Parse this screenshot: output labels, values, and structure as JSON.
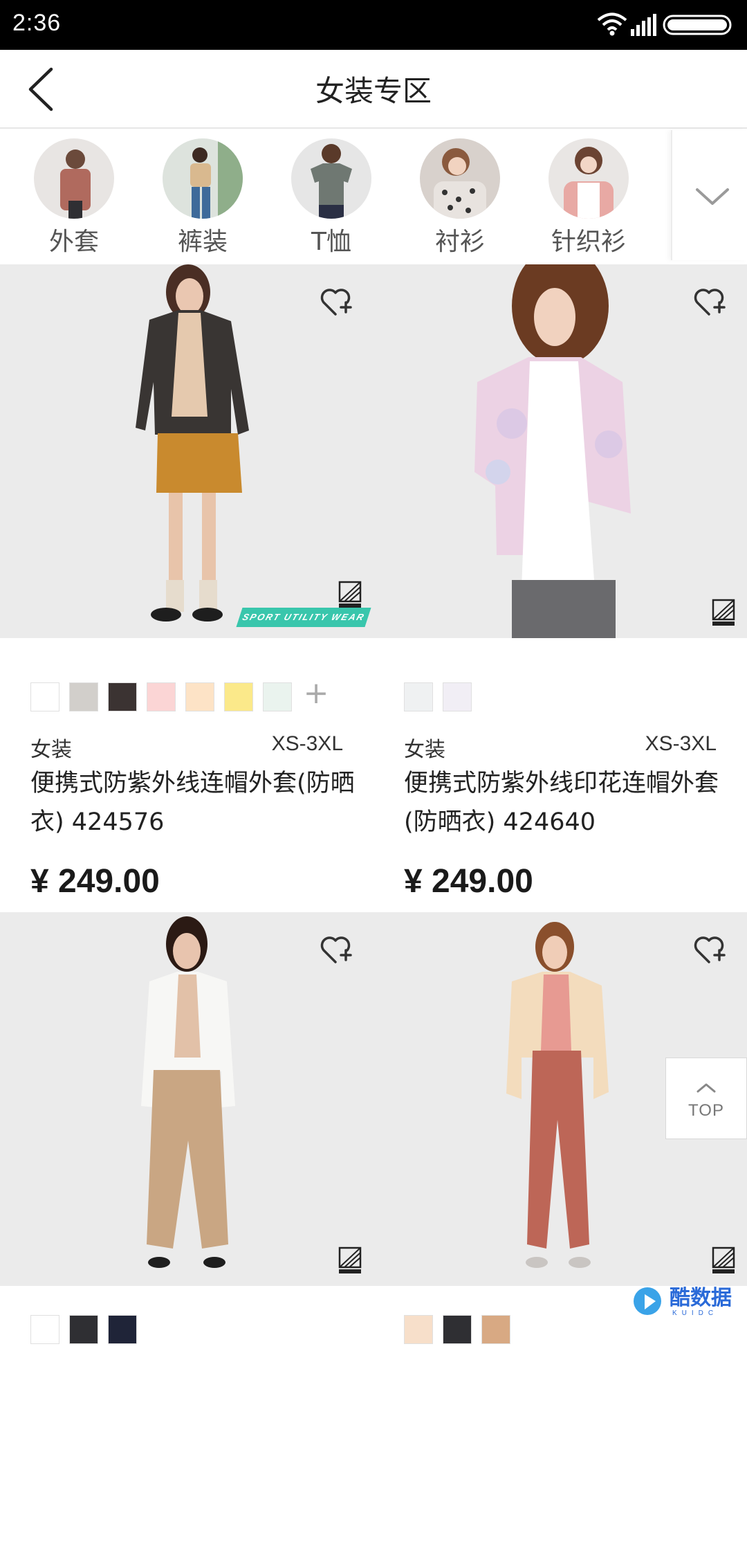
{
  "status_bar": {
    "time": "2:36"
  },
  "header": {
    "title": "女装专区"
  },
  "categories": [
    {
      "label": "外套",
      "thumb_color": "#b06a5e"
    },
    {
      "label": "裤装",
      "thumb_color": "#d9b98f"
    },
    {
      "label": "T恤",
      "thumb_color": "#6f7872"
    },
    {
      "label": "衬衫",
      "thumb_color": "#e8e3df"
    },
    {
      "label": "针织衫",
      "thumb_color": "#e8a9a4"
    }
  ],
  "products": [
    {
      "swatches": [
        "#ffffff",
        "#d2cfcb",
        "#3b3332",
        "#fbd5d5",
        "#fde3c6",
        "#fbe98a",
        "#eaf3ee"
      ],
      "has_more_swatches": true,
      "more_symbol": "+",
      "category": "女装",
      "size": "XS-3XL",
      "name": "便携式防紫外线连帽外套(防晒衣) 424576",
      "price": "¥ 249.00",
      "tag": "SPORT UTILITY WEAR"
    },
    {
      "swatches": [
        "#eff1f2",
        "#f1eef5"
      ],
      "has_more_swatches": false,
      "category": "女装",
      "size": "XS-3XL",
      "name": "便携式防紫外线印花连帽外套(防晒衣) 424640",
      "price": "¥ 249.00"
    },
    {
      "swatches": [
        "#ffffff",
        "#2f2f33",
        "#1f2438"
      ],
      "has_more_swatches": false
    },
    {
      "swatches": [
        "#f7dfca",
        "#2f2f33",
        "#d8a983"
      ],
      "has_more_swatches": false
    }
  ],
  "top_button": {
    "label": "TOP"
  },
  "watermark": {
    "text": "酷数据",
    "sub": "KUIDC"
  },
  "colors": {
    "image_bg": "#ebebeb",
    "accent_teal": "#39c6ac",
    "price": "#1a1a1a"
  }
}
